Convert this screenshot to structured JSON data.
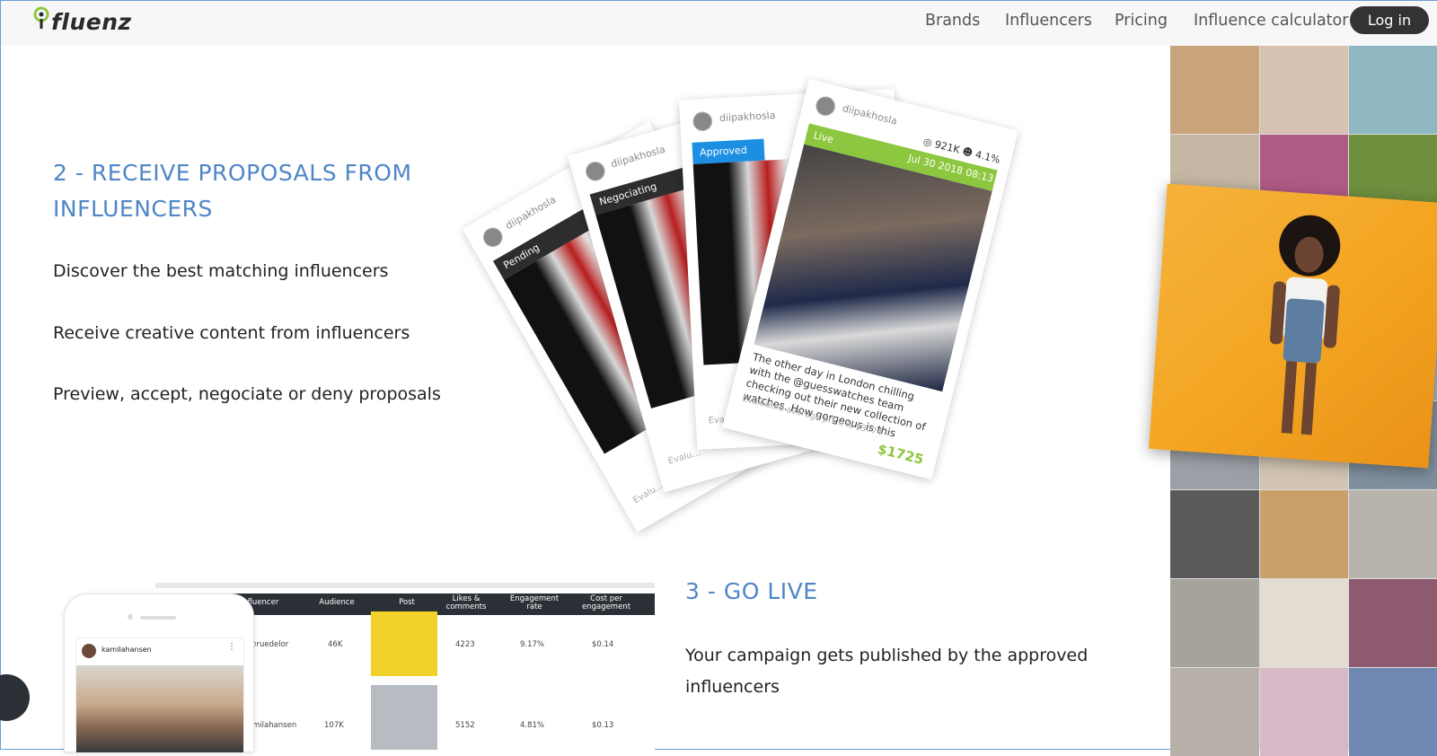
{
  "header": {
    "logo_text": "fluenz",
    "nav": [
      "Brands",
      "Influencers",
      "Pricing",
      "Influence calculator"
    ],
    "login_label": "Log in"
  },
  "section2": {
    "heading": "2 - RECEIVE PROPOSALS FROM INFLUENCERS",
    "features": [
      "Discover the best matching influencers",
      "Receive creative content from influencers",
      "Preview, accept, negociate or deny proposals"
    ]
  },
  "cards": {
    "username": "diipakhosla",
    "statuses": [
      "Pending",
      "Negociating",
      "Approved",
      "Live"
    ],
    "eval_short": "Evalu...",
    "live": {
      "followers": "921K",
      "engagement": "4.1%",
      "date": "Jul 30 2018 08:13",
      "caption": "The other day in London chilling with the @guesswatches team checking out their new collection of watches. How gorgeous is this",
      "eval": "Evaluated average price is $3774",
      "price": "$1725"
    }
  },
  "table": {
    "headers": [
      "Influencer",
      "Audience",
      "Post",
      "Likes & comments",
      "Engagement rate",
      "Cost per engagement"
    ],
    "rows": [
      {
        "influencer": "@ruedelor",
        "audience": "46K",
        "likes": "4223",
        "rate": "9.17%",
        "cpe": "$0.14"
      },
      {
        "influencer": "kamilahansen",
        "audience": "107K",
        "likes": "5152",
        "rate": "4.81%",
        "cpe": "$0.13"
      }
    ]
  },
  "phone": {
    "username": "kamilahansen",
    "dots": "⋮"
  },
  "section3": {
    "heading": "3 - GO LIVE",
    "text": "Your campaign gets published by the approved influencers"
  },
  "colors": {
    "accent": "#4f86c6",
    "live_green": "#8dc73f",
    "approved_blue": "#1c8fe3",
    "dark": "#2d2d2d"
  }
}
